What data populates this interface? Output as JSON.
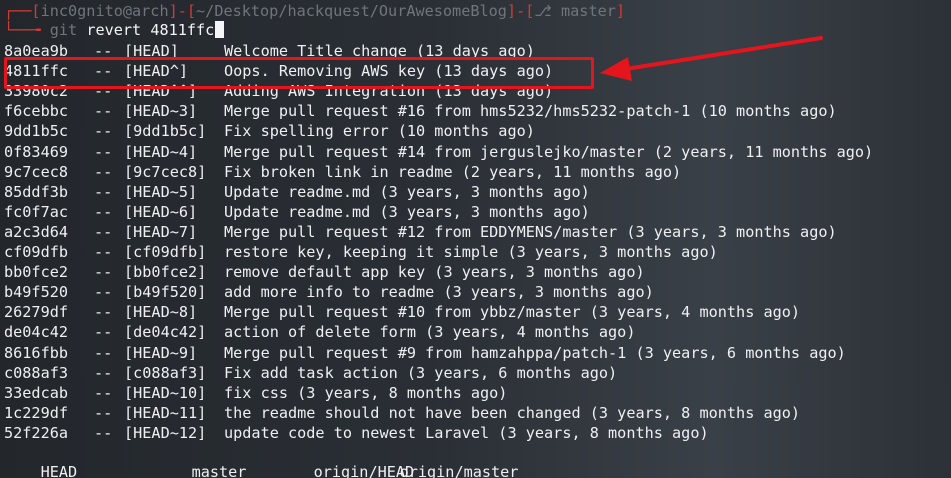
{
  "prompt": {
    "user_host": "inc0gnito@arch",
    "path": "~/Desktop/hackquest/OurAwesomeBlog",
    "branch_icon": "git-branch-icon",
    "branch": "master"
  },
  "command": {
    "program": "git",
    "args": "revert 4811ffc"
  },
  "log": [
    {
      "hash": "8a0ea9b",
      "ref": "[HEAD]",
      "message": "Welcome Title change (13 days ago)"
    },
    {
      "hash": "4811ffc",
      "ref": "[HEAD^]",
      "message": "Oops. Removing AWS key (13 days ago)"
    },
    {
      "hash": "33980c2",
      "ref": "[HEAD^^]",
      "message": "Adding AWS Integration (13 days ago)"
    },
    {
      "hash": "f6cebbc",
      "ref": "[HEAD~3]",
      "message": "Merge pull request #16 from hms5232/hms5232-patch-1 (10 months ago)"
    },
    {
      "hash": "9dd1b5c",
      "ref": "[9dd1b5c]",
      "message": "Fix spelling error (10 months ago)"
    },
    {
      "hash": "0f83469",
      "ref": "[HEAD~4]",
      "message": "Merge pull request #14 from jerguslejko/master (2 years, 11 months ago)"
    },
    {
      "hash": "9c7cec8",
      "ref": "[9c7cec8]",
      "message": "Fix broken link in readme (2 years, 11 months ago)"
    },
    {
      "hash": "85ddf3b",
      "ref": "[HEAD~5]",
      "message": "Update readme.md (3 years, 3 months ago)"
    },
    {
      "hash": "fc0f7ac",
      "ref": "[HEAD~6]",
      "message": "Update readme.md (3 years, 3 months ago)"
    },
    {
      "hash": "a2c3d64",
      "ref": "[HEAD~7]",
      "message": "Merge pull request #12 from EDDYMENS/master (3 years, 3 months ago)"
    },
    {
      "hash": "cf09dfb",
      "ref": "[cf09dfb]",
      "message": "restore key, keeping it simple (3 years, 3 months ago)"
    },
    {
      "hash": "bb0fce2",
      "ref": "[bb0fce2]",
      "message": "remove default app key (3 years, 3 months ago)"
    },
    {
      "hash": "b49f520",
      "ref": "[b49f520]",
      "message": "add more info to readme (3 years, 3 months ago)"
    },
    {
      "hash": "26279df",
      "ref": "[HEAD~8]",
      "message": "Merge pull request #10 from ybbz/master (3 years, 4 months ago)"
    },
    {
      "hash": "de04c42",
      "ref": "[de04c42]",
      "message": "action of delete form (3 years, 4 months ago)"
    },
    {
      "hash": "8616fbb",
      "ref": "[HEAD~9]",
      "message": "Merge pull request #9 from hamzahppa/patch-1 (3 years, 6 months ago)"
    },
    {
      "hash": "c088af3",
      "ref": "[c088af3]",
      "message": "Fix add task action (3 years, 6 months ago)"
    },
    {
      "hash": "33edcab",
      "ref": "[HEAD~10]",
      "message": "fix css (3 years, 8 months ago)"
    },
    {
      "hash": "1c229df",
      "ref": "[HEAD~11]",
      "message": "the readme should not have been changed (3 years, 8 months ago)"
    },
    {
      "hash": "52f226a",
      "ref": "[HEAD~12]",
      "message": "update code to newest Laravel (3 years, 8 months ago)"
    }
  ],
  "separator": "--",
  "refs": [
    "HEAD",
    "master",
    "origin/HEAD",
    "origin/master"
  ],
  "colors": {
    "highlight": "#e4151c",
    "prompt_bracket": "#d53b35",
    "text": "#eef0f2",
    "dim": "#6f757b"
  }
}
